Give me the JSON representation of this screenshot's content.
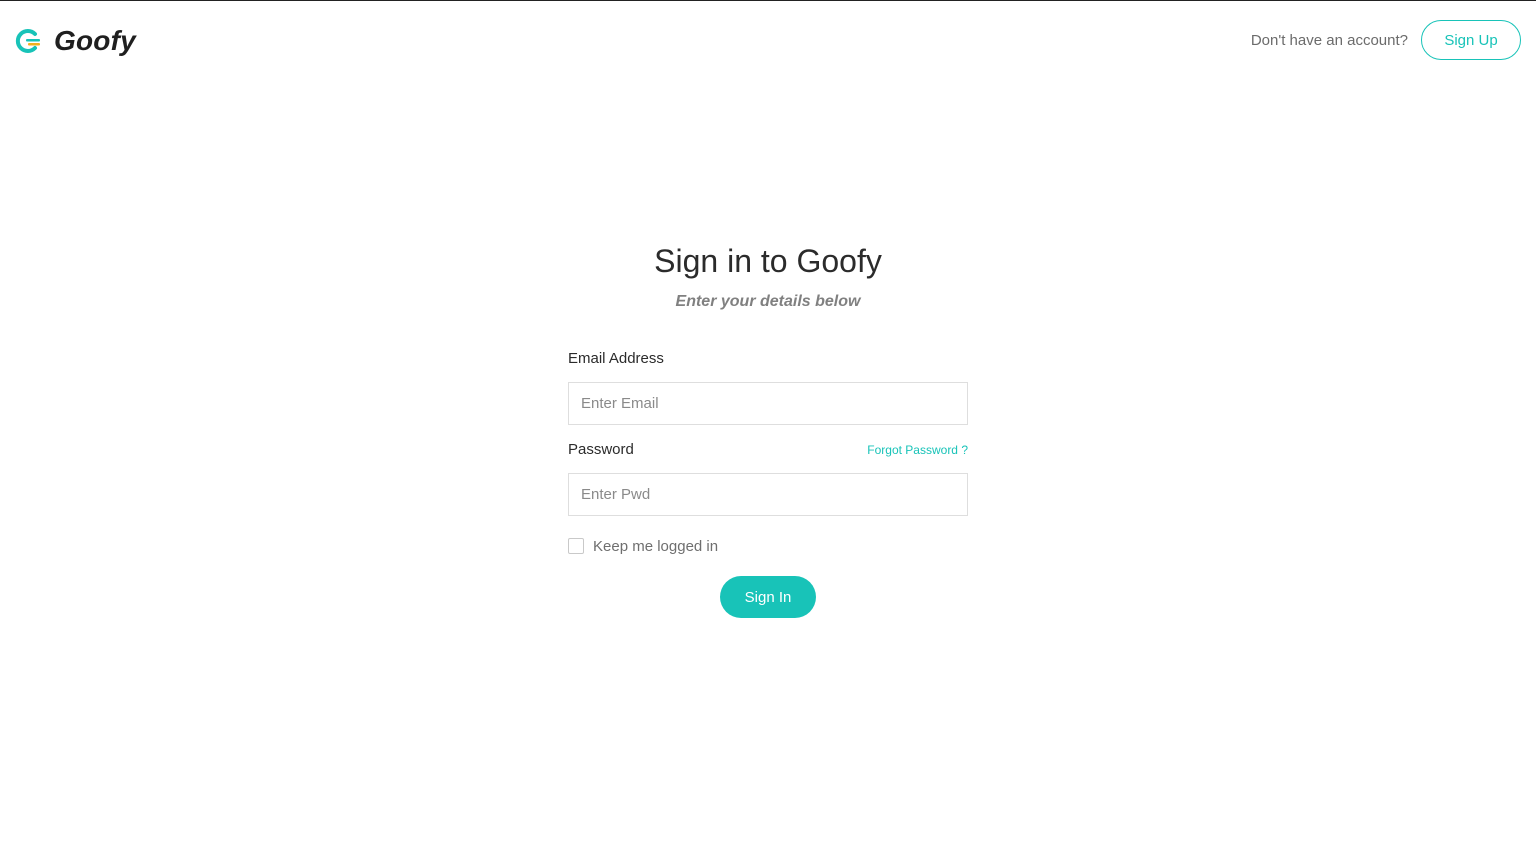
{
  "header": {
    "brand_name": "Goofy",
    "account_prompt": "Don't have an account?",
    "signup_label": "Sign Up"
  },
  "form": {
    "title": "Sign in to Goofy",
    "subtitle": "Enter your details below",
    "email_label": "Email Address",
    "email_placeholder": "Enter Email",
    "email_value": "",
    "password_label": "Password",
    "forgot_label": "Forgot Password ?",
    "password_placeholder": "Enter Pwd",
    "password_value": "",
    "keep_logged_in_label": "Keep me logged in",
    "keep_logged_in_checked": false,
    "signin_label": "Sign In"
  },
  "icons": {
    "brand_logo": "goofy-logo-icon"
  },
  "colors": {
    "accent": "#18c3b8",
    "text_dark": "#2b2b2b",
    "text_muted": "#808080",
    "logo_yellow": "#f2b01e"
  }
}
